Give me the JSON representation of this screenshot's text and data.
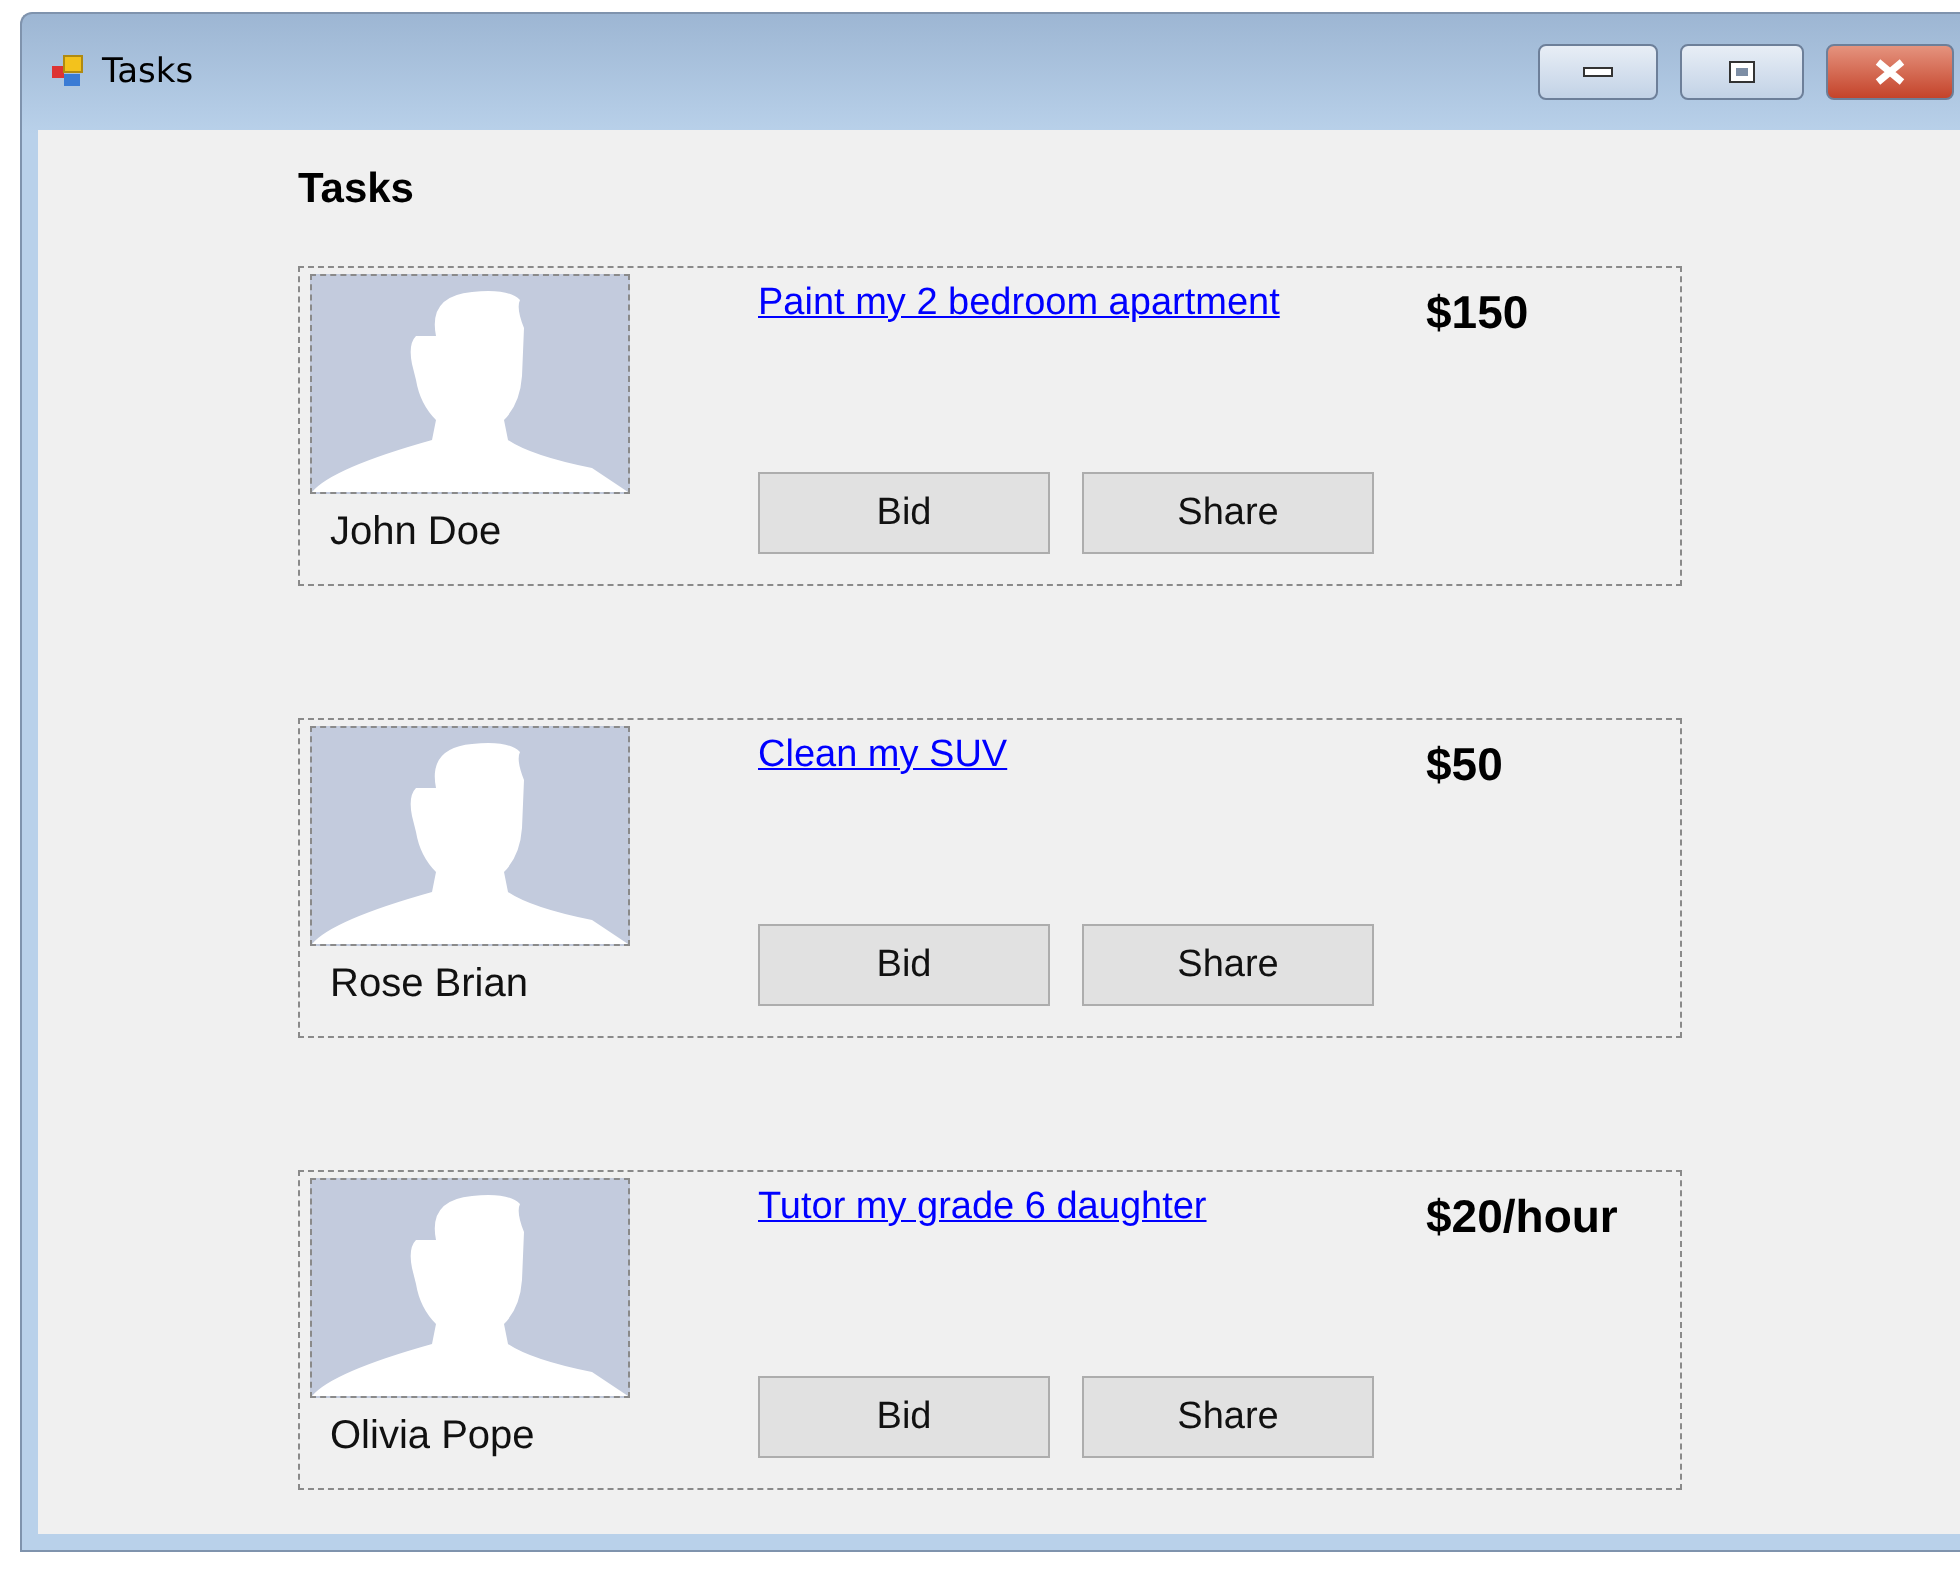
{
  "window": {
    "title": "Tasks"
  },
  "heading": "Tasks",
  "tasks": [
    {
      "owner": "John Doe",
      "title": "Paint my 2 bedroom apartment",
      "price": "$150",
      "buttons": [
        "Bid",
        "Share"
      ]
    },
    {
      "owner": "Rose Brian",
      "title": "Clean my SUV",
      "price": "$50",
      "buttons": [
        "Bid",
        "Share"
      ]
    },
    {
      "owner": "Olivia Pope",
      "title": "Tutor my grade 6 daughter",
      "price": "$20/hour",
      "buttons": [
        "Bid",
        "Share"
      ]
    }
  ]
}
